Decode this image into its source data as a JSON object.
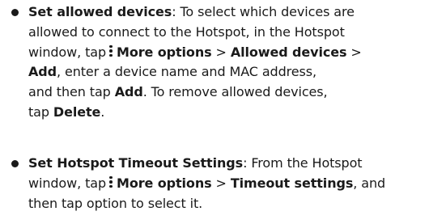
{
  "icons": {
    "more_options": "vertical-ellipsis-icon"
  },
  "items": [
    {
      "title": "Set allowed devices",
      "colon": ":",
      "intro": " To select which devices are",
      "l2": "allowed to connect to the Hotspot, in the Hotspot",
      "l3a": "window, tap",
      "more_options": "More options",
      "sep1": " > ",
      "allowed_devices": "Allowed devices",
      "sep2": " >",
      "add1": "Add",
      "l4rest": ", enter a device name and MAC address,",
      "l5a": "and then tap ",
      "add2": "Add",
      "l5b": ". To remove allowed devices,",
      "l6a": "tap ",
      "delete": "Delete",
      "l6b": "."
    },
    {
      "title": "Set Hotspot Timeout Settings",
      "colon": ":",
      "intro": " From the Hotspot",
      "l2a": "window, tap",
      "more_options": "More options",
      "sep1": " > ",
      "timeout_settings": "Timeout settings",
      "l2b": ", and",
      "l3": "then tap option to select it."
    }
  ]
}
